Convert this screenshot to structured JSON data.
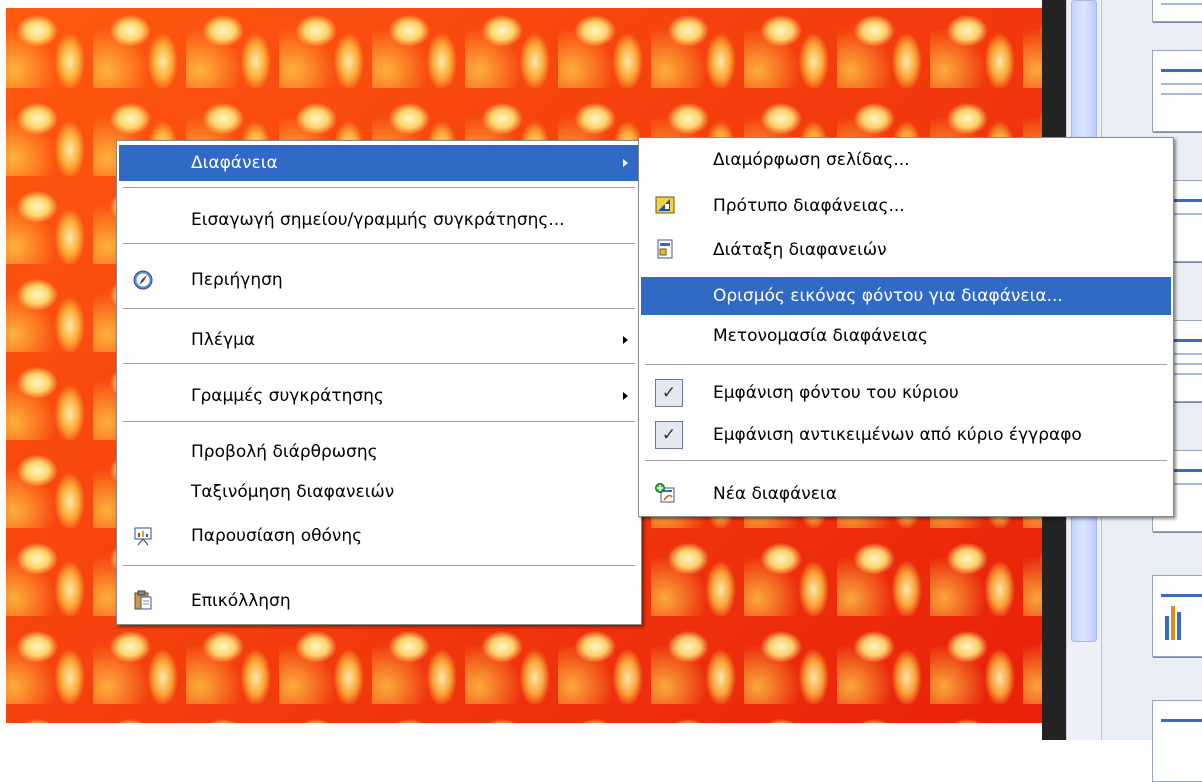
{
  "main_menu": {
    "items": [
      {
        "label": "Διαφάνεια",
        "highlighted": true,
        "submenu": true
      },
      {
        "label": "Εισαγωγή σημείου/γραμμής συγκράτησης..."
      },
      {
        "label": "Περιήγηση",
        "icon": "navigator-compass-icon"
      },
      {
        "label": "Πλέγμα",
        "submenu": true
      },
      {
        "label": "Γραμμές συγκράτησης",
        "submenu": true
      },
      {
        "label": "Προβολή διάρθρωσης"
      },
      {
        "label": "Ταξινόμηση διαφανειών"
      },
      {
        "label": "Παρουσίαση οθόνης",
        "icon": "slideshow-presentation-icon"
      },
      {
        "label": "Επικόλληση",
        "icon": "paste-clipboard-icon"
      }
    ]
  },
  "sub_menu": {
    "items": [
      {
        "label": "Διαμόρφωση σελίδας..."
      },
      {
        "label": "Πρότυπο διαφάνειας...",
        "icon": "slide-design-icon"
      },
      {
        "label": "Διάταξη διαφανειών",
        "icon": "slide-layout-icon"
      },
      {
        "label": "Ορισμός εικόνας φόντου για διαφάνεια...",
        "highlighted": true
      },
      {
        "label": "Μετονομασία διαφάνειας"
      },
      {
        "label": "Εμφάνιση φόντου του κύριου",
        "checked": true
      },
      {
        "label": "Εμφάνιση αντικειμένων από κύριο έγγραφο",
        "checked": true
      },
      {
        "label": "Νέα διαφάνεια",
        "icon": "new-slide-icon"
      }
    ]
  },
  "colors": {
    "highlight": "#316ac5",
    "slide_background": "#f23a0c",
    "menu_background": "#ffffff"
  }
}
